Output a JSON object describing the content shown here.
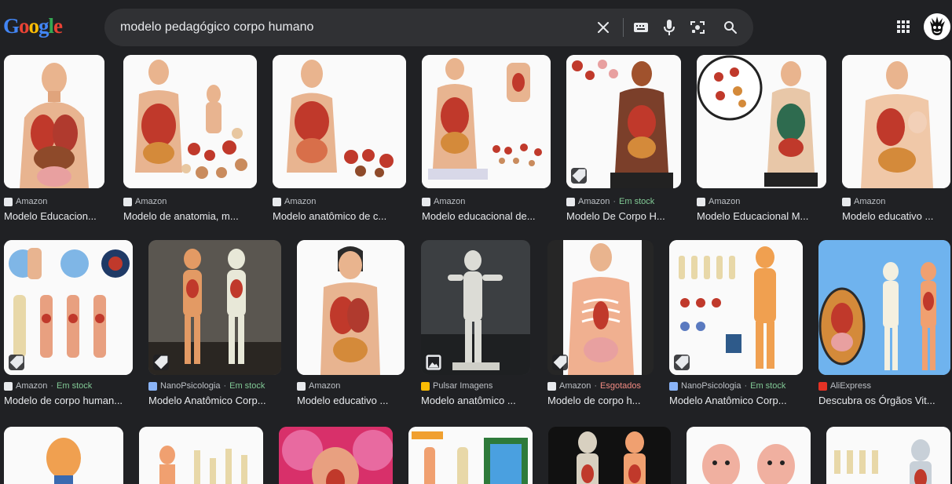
{
  "header": {
    "logo_letters": [
      "G",
      "o",
      "o",
      "g",
      "l",
      "e"
    ],
    "search_query": "modelo pedagógico corpo humano",
    "icons": [
      "close-icon",
      "keyboard-icon",
      "microphone-icon",
      "camera-icon",
      "search-icon",
      "apps-icon",
      "avatar"
    ]
  },
  "colors": {
    "background": "#202124",
    "searchbox": "#303134",
    "in_stock": "#81c995",
    "sold_out": "#f28b82",
    "amazon_favicon": "#e8eaed",
    "nanopsicologia_favicon": "#8ab4f8",
    "pulsar_favicon": "#fbbc04",
    "aliexpress_favicon": "#e43225"
  },
  "rows": [
    {
      "items": [
        {
          "source": "Amazon",
          "status": "",
          "title": "Modelo Educacion..."
        },
        {
          "source": "Amazon",
          "status": "",
          "title": "Modelo de anatomia, m..."
        },
        {
          "source": "Amazon",
          "status": "",
          "title": "Modelo anatômico de c..."
        },
        {
          "source": "Amazon",
          "status": "",
          "title": "Modelo educacional de..."
        },
        {
          "source": "Amazon",
          "status": "Em stock",
          "title": "Modelo De Corpo H..."
        },
        {
          "source": "Amazon",
          "status": "",
          "title": "Modelo Educacional M..."
        },
        {
          "source": "Amazon",
          "status": "",
          "title": "Modelo educativo ..."
        }
      ]
    },
    {
      "items": [
        {
          "source": "Amazon",
          "status": "Em stock",
          "title": "Modelo de corpo human..."
        },
        {
          "source": "NanoPsicologia",
          "status": "Em stock",
          "title": "Modelo Anatômico Corp..."
        },
        {
          "source": "Amazon",
          "status": "",
          "title": "Modelo educativo ..."
        },
        {
          "source": "Pulsar Imagens",
          "status": "",
          "title": "Modelo anatômico ..."
        },
        {
          "source": "Amazon",
          "status": "Esgotados",
          "title": "Modelo de corpo h..."
        },
        {
          "source": "NanoPsicologia",
          "status": "Em stock",
          "title": "Modelo Anatômico Corp..."
        },
        {
          "source": "AliExpress",
          "status": "",
          "title": "Descubra os Órgãos Vit..."
        }
      ]
    }
  ]
}
